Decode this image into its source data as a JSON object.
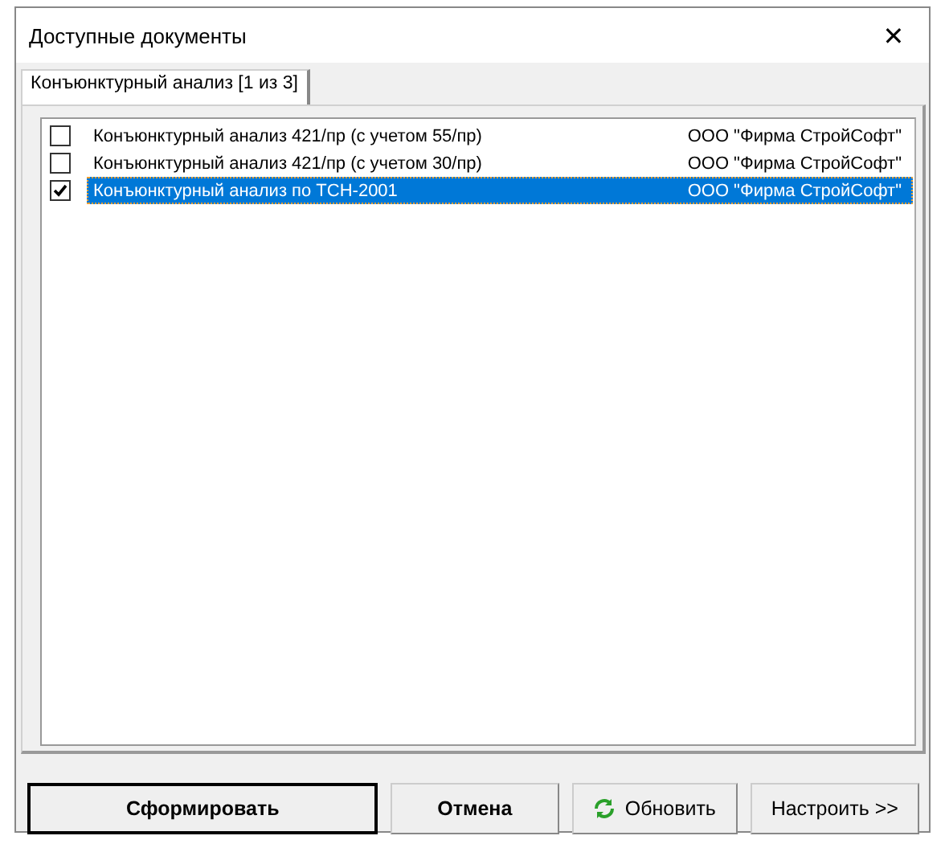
{
  "window": {
    "title": "Доступные документы",
    "close": "✕"
  },
  "tabs": [
    {
      "label": "Конъюнктурный анализ [1 из 3]",
      "selected": true
    }
  ],
  "documents": [
    {
      "name": "Конъюнктурный анализ 421/пр (с учетом 55/пр)",
      "author": "ООО \"Фирма СтройСофт\"",
      "checked": false,
      "selected": false
    },
    {
      "name": "Конъюнктурный анализ 421/пр (с учетом 30/пр)",
      "author": "ООО \"Фирма СтройСофт\"",
      "checked": false,
      "selected": false
    },
    {
      "name": "Конъюнктурный анализ по ТСН-2001",
      "author": "ООО \"Фирма СтройСофт\"",
      "checked": true,
      "selected": true
    }
  ],
  "buttons": [
    {
      "label": "Сформировать",
      "kind": "default"
    },
    {
      "label": "Отмена",
      "kind": "bold"
    },
    {
      "label": "Обновить",
      "kind": "refresh"
    },
    {
      "label": "Настроить >>",
      "kind": "plain"
    }
  ]
}
